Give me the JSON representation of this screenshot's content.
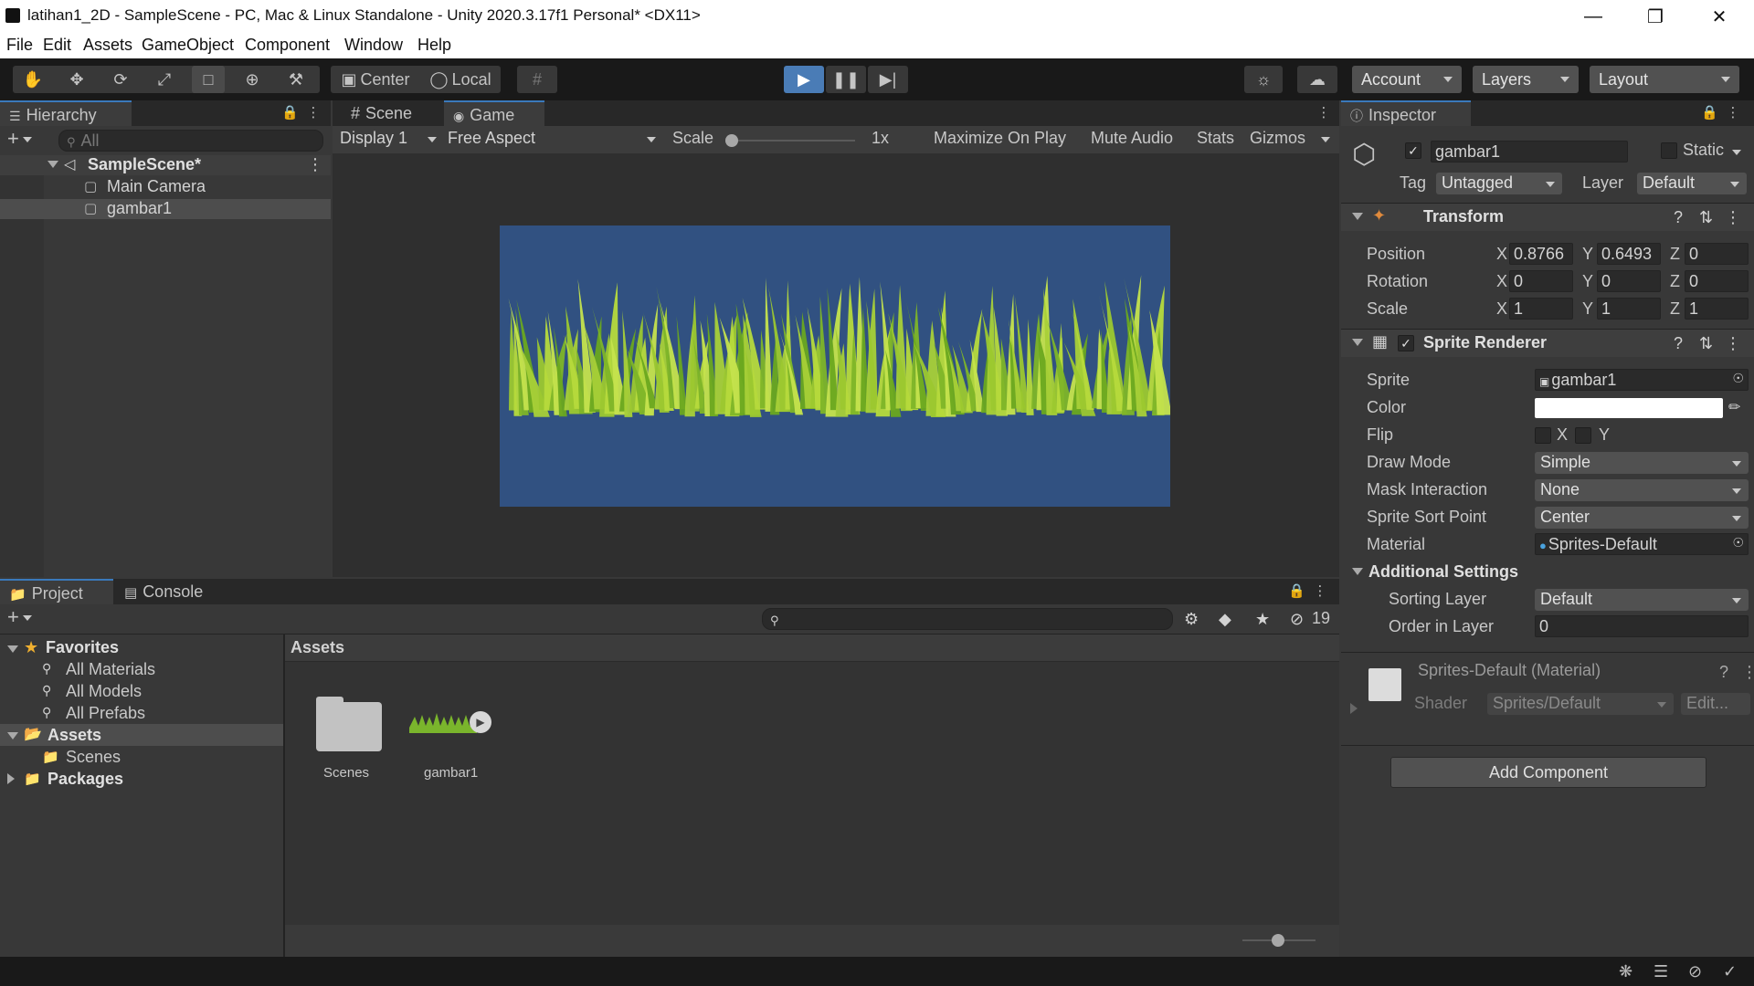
{
  "window": {
    "title": "latihan1_2D - SampleScene - PC, Mac & Linux Standalone - Unity 2020.3.17f1 Personal* <DX11>"
  },
  "menu": [
    "File",
    "Edit",
    "Assets",
    "GameObject",
    "Component",
    "Window",
    "Help"
  ],
  "toolbar": {
    "pivot": "Center",
    "space": "Local",
    "account": "Account",
    "layers": "Layers",
    "layout": "Layout"
  },
  "hierarchy": {
    "tab": "Hierarchy",
    "search_placeholder": "All",
    "scene": "SampleScene*",
    "items": [
      "Main Camera",
      "gambar1"
    ]
  },
  "scene_view": {
    "tab_scene": "Scene",
    "tab_game": "Game",
    "display": "Display 1",
    "aspect": "Free Aspect",
    "scale_label": "Scale",
    "scale_value": "1x",
    "maximize": "Maximize On Play",
    "mute": "Mute Audio",
    "stats": "Stats",
    "gizmos": "Gizmos",
    "bg_color": "#315181"
  },
  "inspector": {
    "tab": "Inspector",
    "object_name": "gambar1",
    "static": "Static",
    "tag_label": "Tag",
    "tag": "Untagged",
    "layer_label": "Layer",
    "layer": "Default",
    "transform": {
      "title": "Transform",
      "position_label": "Position",
      "rotation_label": "Rotation",
      "scale_label": "Scale",
      "position": {
        "x": "0.8766",
        "y": "0.6493",
        "z": "0"
      },
      "rotation": {
        "x": "0",
        "y": "0",
        "z": "0"
      },
      "scale": {
        "x": "1",
        "y": "1",
        "z": "1"
      }
    },
    "sprite_renderer": {
      "title": "Sprite Renderer",
      "sprite_label": "Sprite",
      "sprite": "gambar1",
      "color_label": "Color",
      "flip_label": "Flip",
      "flip_x": "X",
      "flip_y": "Y",
      "draw_mode_label": "Draw Mode",
      "draw_mode": "Simple",
      "mask_label": "Mask Interaction",
      "mask": "None",
      "sort_point_label": "Sprite Sort Point",
      "sort_point": "Center",
      "material_label": "Material",
      "material": "Sprites-Default",
      "additional": "Additional Settings",
      "sorting_layer_label": "Sorting Layer",
      "sorting_layer": "Default",
      "order_label": "Order in Layer",
      "order": "0"
    },
    "material": {
      "title": "Sprites-Default (Material)",
      "shader_label": "Shader",
      "shader": "Sprites/Default",
      "edit": "Edit..."
    },
    "add_component": "Add Component"
  },
  "project": {
    "tab_project": "Project",
    "tab_console": "Console",
    "hidden_count": "19",
    "favorites": "Favorites",
    "fav_items": [
      "All Materials",
      "All Models",
      "All Prefabs"
    ],
    "assets": "Assets",
    "asset_children": [
      "Scenes"
    ],
    "packages": "Packages",
    "breadcrumb": "Assets",
    "files": [
      "Scenes",
      "gambar1"
    ]
  }
}
